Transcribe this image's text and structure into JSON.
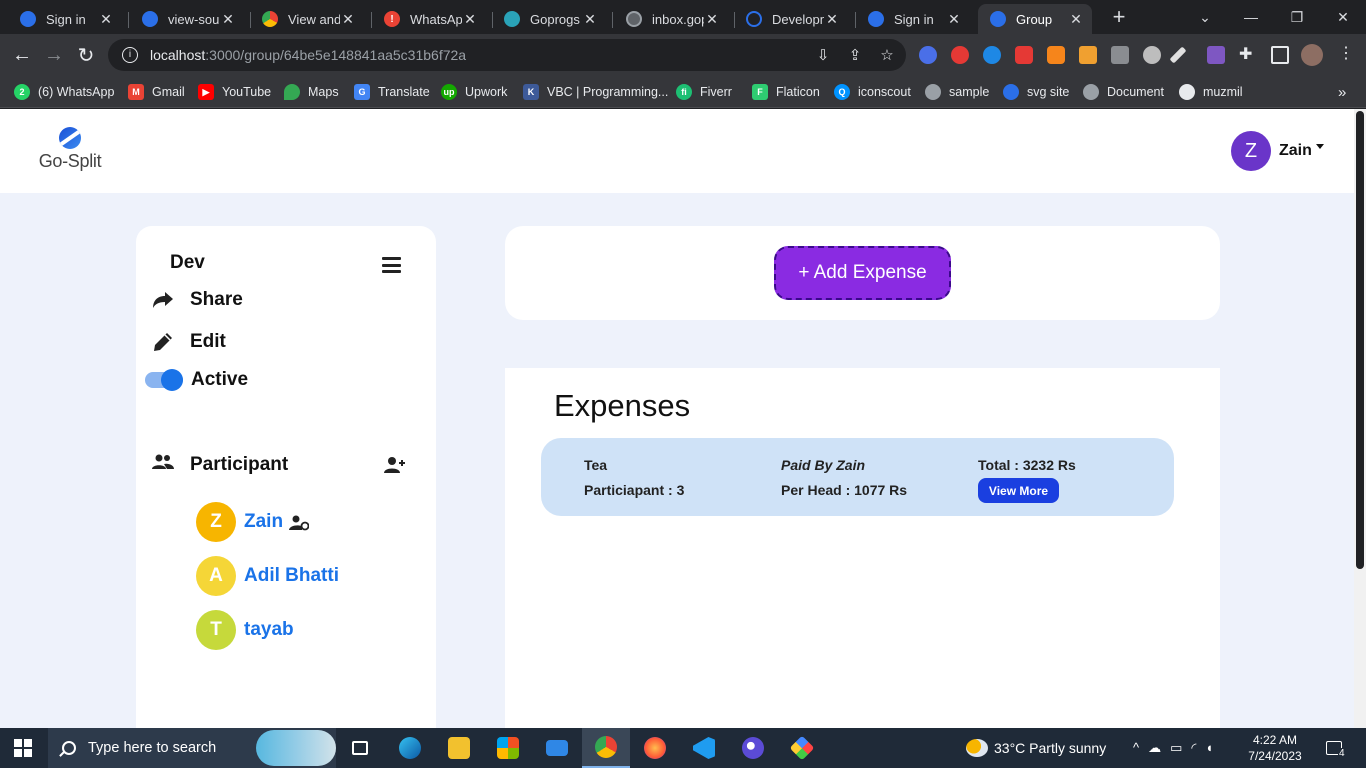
{
  "browser": {
    "tabs": [
      {
        "title": "Sign in",
        "favicon_color": "#2b6fe8"
      },
      {
        "title": "view-sourc",
        "favicon_color": "#2b6fe8"
      },
      {
        "title": "View and e",
        "favicon_color": "#34a853"
      },
      {
        "title": "WhatsApp",
        "favicon_color": "#ea4335"
      },
      {
        "title": "Goprogs C",
        "favicon_color": "#2aa3b8"
      },
      {
        "title": "inbox.gopr",
        "favicon_color": "#9aa0a6"
      },
      {
        "title": "Developm",
        "favicon_color": "#2b6fe8"
      },
      {
        "title": "Sign in",
        "favicon_color": "#2b6fe8"
      },
      {
        "title": "Group",
        "favicon_color": "#2b6fe8"
      }
    ],
    "active_tab_index": 8,
    "address": {
      "host": "localhost",
      "path": ":3000/group/64be5e148841aa5c31b6f72a"
    },
    "bookmarks": [
      {
        "label": "(6) WhatsApp",
        "color": "#25d366",
        "glyph": "2"
      },
      {
        "label": "Gmail",
        "color": "#ea4335",
        "glyph": "M"
      },
      {
        "label": "YouTube",
        "color": "#ff0000",
        "glyph": "▶"
      },
      {
        "label": "Maps",
        "color": "#34a853",
        "glyph": "•"
      },
      {
        "label": "Translate",
        "color": "#4285f4",
        "glyph": "G"
      },
      {
        "label": "Upwork",
        "color": "#14a800",
        "glyph": "up"
      },
      {
        "label": "VBC | Programming...",
        "color": "#3d5a99",
        "glyph": "K"
      },
      {
        "label": "Fiverr",
        "color": "#1dbf73",
        "glyph": "fi"
      },
      {
        "label": "Flaticon",
        "color": "#2ecc71",
        "glyph": "F"
      },
      {
        "label": "iconscout",
        "color": "#0093ff",
        "glyph": "Q"
      },
      {
        "label": "sample",
        "color": "#9aa0a6",
        "glyph": "◎"
      },
      {
        "label": "svg site",
        "color": "#2b6fe8",
        "glyph": "S"
      },
      {
        "label": "Document",
        "color": "#9aa0a6",
        "glyph": "◎"
      },
      {
        "label": "muzmil",
        "color": "#e8eaed",
        "glyph": "●"
      }
    ]
  },
  "app": {
    "logo_text": "Go-Split",
    "user": {
      "initial": "Z",
      "name": "Zain",
      "avatar_color": "#6a35c9"
    },
    "group": {
      "name": "Dev",
      "share_label": "Share",
      "edit_label": "Edit",
      "active_label": "Active",
      "active": true
    },
    "participants": {
      "heading": "Participant",
      "members": [
        {
          "initial": "Z",
          "name": "Zain",
          "color": "#f7b500",
          "admin": true
        },
        {
          "initial": "A",
          "name": "Adil Bhatti",
          "color": "#f5d637",
          "admin": false
        },
        {
          "initial": "T",
          "name": "tayab",
          "color": "#c6d93b",
          "admin": false
        }
      ]
    },
    "add_expense_label": "+ Add Expense",
    "expenses_title": "Expenses",
    "expenses": [
      {
        "name": "Tea",
        "participants": "Particiapant : 3",
        "paid_by": "Paid By Zain",
        "per_head": "Per Head : 1077 Rs",
        "total": "Total : 3232 Rs",
        "view_more_label": "View More"
      }
    ]
  },
  "taskbar": {
    "search_placeholder": "Type here to search",
    "weather": "33°C  Partly sunny",
    "time": "4:22 AM",
    "date": "7/24/2023",
    "notification_count": "4"
  }
}
